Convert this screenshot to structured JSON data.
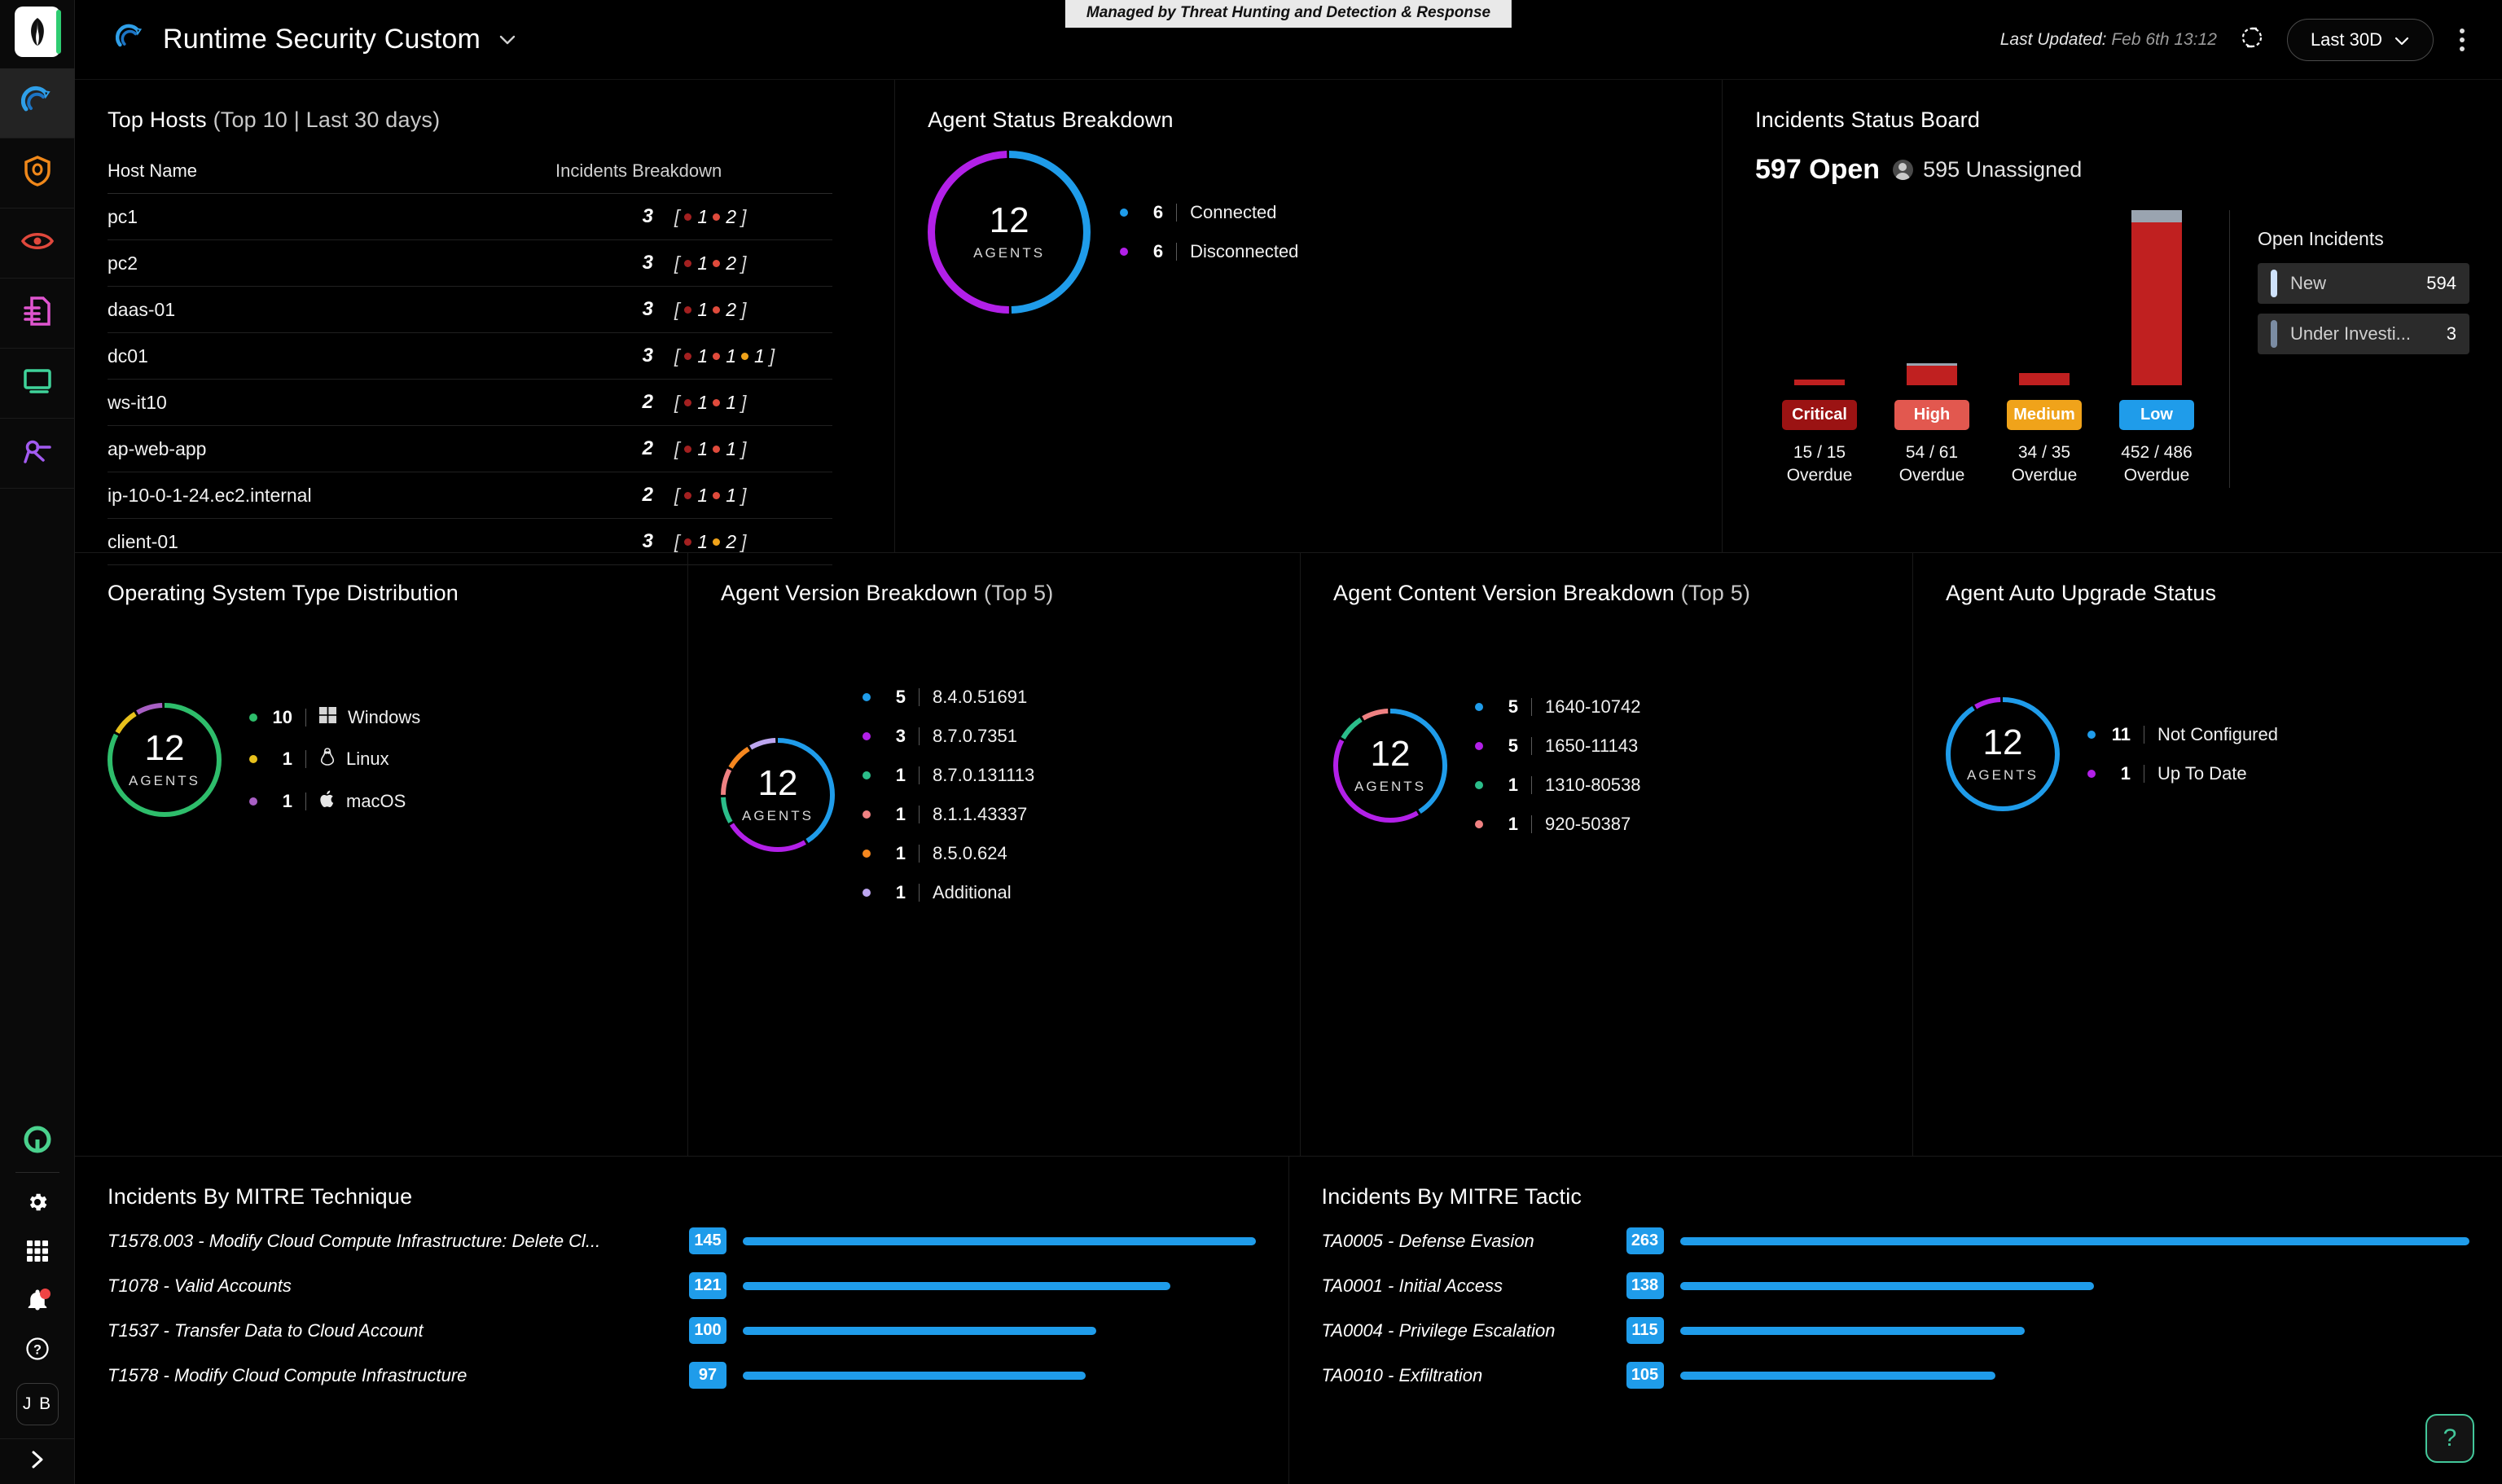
{
  "sidebar": {
    "logo_icon": "sentinelone-logo-icon",
    "nav_items": [
      {
        "name": "dashboard",
        "icon": "speedometer-icon",
        "color": "#2f9fe8",
        "active": true
      },
      {
        "name": "endpoint-protection",
        "icon": "shield-icon",
        "color": "#f0881a",
        "active": false
      },
      {
        "name": "visibility",
        "icon": "eye-icon",
        "color": "#e0483c",
        "active": false
      },
      {
        "name": "reports",
        "icon": "document-icon",
        "color": "#e055cf",
        "active": false
      },
      {
        "name": "devices",
        "icon": "monitor-icon",
        "color": "#3fd39a",
        "active": false
      },
      {
        "name": "integrations",
        "icon": "node-graph-icon",
        "color": "#a25bf0",
        "active": false
      }
    ],
    "bottom_items": [
      {
        "name": "singularity-marketplace",
        "icon": "ring-icon"
      },
      {
        "name": "settings",
        "icon": "gear-icon"
      },
      {
        "name": "apps-grid",
        "icon": "grid-icon"
      },
      {
        "name": "notifications",
        "icon": "bell-icon",
        "badge": true
      },
      {
        "name": "help",
        "icon": "question-circle-icon"
      }
    ],
    "avatar_initials": "J B",
    "expander_icon": "chevron-right-icon"
  },
  "header": {
    "title": "Runtime Security Custom",
    "title_chevron": "chevron-down-icon",
    "brand_icon": "speedometer-icon",
    "managed_banner": "Managed by Threat Hunting and Detection & Response",
    "last_updated_label": "Last Updated:",
    "last_updated_value": "Feb 6th 13:12",
    "refresh_icon": "refresh-icon",
    "time_range": "Last 30D",
    "time_range_chevron": "chevron-down-icon",
    "menu_icon": "kebab-menu-icon"
  },
  "top_hosts": {
    "title": "Top Hosts",
    "title_sub": "(Top 10 | Last 30 days)",
    "columns": [
      "Host Name",
      "Incidents Breakdown"
    ],
    "rows": [
      {
        "host": "pc1",
        "count": "3",
        "breakdown": [
          {
            "color": "#a32020",
            "value": "1"
          },
          {
            "color": "#e04b3c",
            "value": "2"
          }
        ]
      },
      {
        "host": "pc2",
        "count": "3",
        "breakdown": [
          {
            "color": "#a32020",
            "value": "1"
          },
          {
            "color": "#e04b3c",
            "value": "2"
          }
        ]
      },
      {
        "host": "daas-01",
        "count": "3",
        "breakdown": [
          {
            "color": "#a32020",
            "value": "1"
          },
          {
            "color": "#e04b3c",
            "value": "2"
          }
        ]
      },
      {
        "host": "dc01",
        "count": "3",
        "breakdown": [
          {
            "color": "#a32020",
            "value": "1"
          },
          {
            "color": "#e04b3c",
            "value": "1"
          },
          {
            "color": "#f0a31a",
            "value": "1"
          }
        ]
      },
      {
        "host": "ws-it10",
        "count": "2",
        "breakdown": [
          {
            "color": "#a32020",
            "value": "1"
          },
          {
            "color": "#e04b3c",
            "value": "1"
          }
        ]
      },
      {
        "host": "ap-web-app",
        "count": "2",
        "breakdown": [
          {
            "color": "#a32020",
            "value": "1"
          },
          {
            "color": "#e04b3c",
            "value": "1"
          }
        ]
      },
      {
        "host": "ip-10-0-1-24.ec2.internal",
        "count": "2",
        "breakdown": [
          {
            "color": "#a32020",
            "value": "1"
          },
          {
            "color": "#e04b3c",
            "value": "1"
          }
        ]
      },
      {
        "host": "client-01",
        "count": "3",
        "breakdown": [
          {
            "color": "#a32020",
            "value": "1"
          },
          {
            "color": "#f0a31a",
            "value": "2"
          }
        ]
      }
    ]
  },
  "agent_status": {
    "title": "Agent Status Breakdown",
    "center_value": "12",
    "center_label": "AGENTS",
    "legend": [
      {
        "value": "6",
        "label": "Connected",
        "color": "#1f9cea"
      },
      {
        "value": "6",
        "label": "Disconnected",
        "color": "#b220e8"
      }
    ]
  },
  "incidents_status_board": {
    "title": "Incidents Status Board",
    "open_count": "597 Open",
    "unassigned": "595 Unassigned",
    "unassigned_icon": "person-icon",
    "severities": [
      {
        "label": "Critical",
        "pill_color": "#9b1313",
        "overdue": "15",
        "total": "15",
        "sub": "15 / 15",
        "sub2": "Overdue"
      },
      {
        "label": "High",
        "pill_color": "#e2584f",
        "overdue": "54",
        "total": "61",
        "sub": "54 / 61",
        "sub2": "Overdue"
      },
      {
        "label": "Medium",
        "pill_color": "#f0a31a",
        "overdue": "34",
        "total": "35",
        "sub": "34 / 35",
        "sub2": "Overdue"
      },
      {
        "label": "Low",
        "pill_color": "#1f9cea",
        "overdue": "452",
        "total": "486",
        "sub": "452 / 486",
        "sub2": "Overdue"
      }
    ],
    "open_incidents_title": "Open Incidents",
    "open_incidents": [
      {
        "label": "New",
        "count": "594",
        "accent": "#cfe2fa"
      },
      {
        "label": "Under Investi...",
        "count": "3",
        "accent": "#7b8ca3"
      }
    ]
  },
  "os_distribution": {
    "title": "Operating System Type Distribution",
    "center_value": "12",
    "center_label": "AGENTS",
    "legend": [
      {
        "value": "10",
        "label": "Windows",
        "color": "#2ebd6b",
        "icon": "windows-icon"
      },
      {
        "value": "1",
        "label": "Linux",
        "color": "#e8c11c",
        "icon": "linux-icon"
      },
      {
        "value": "1",
        "label": "macOS",
        "color": "#a85fc4",
        "icon": "apple-icon"
      }
    ]
  },
  "agent_version": {
    "title": "Agent Version Breakdown",
    "title_sub": "(Top 5)",
    "center_value": "12",
    "center_label": "AGENTS",
    "legend": [
      {
        "value": "5",
        "label": "8.4.0.51691",
        "color": "#1f9cea"
      },
      {
        "value": "3",
        "label": "8.7.0.7351",
        "color": "#b220e8"
      },
      {
        "value": "1",
        "label": "8.7.0.131113",
        "color": "#2bbd8a"
      },
      {
        "value": "1",
        "label": "8.1.1.43337",
        "color": "#ef8182"
      },
      {
        "value": "1",
        "label": "8.5.0.624",
        "color": "#f5871f"
      },
      {
        "value": "1",
        "label": "Additional",
        "color": "#bda6f0"
      }
    ]
  },
  "agent_content_version": {
    "title": "Agent Content Version Breakdown",
    "title_sub": "(Top 5)",
    "center_value": "12",
    "center_label": "AGENTS",
    "legend": [
      {
        "value": "5",
        "label": "1640-10742",
        "color": "#1f9cea"
      },
      {
        "value": "5",
        "label": "1650-11143",
        "color": "#b220e8"
      },
      {
        "value": "1",
        "label": "1310-80538",
        "color": "#2bbd8a"
      },
      {
        "value": "1",
        "label": "920-50387",
        "color": "#ef8182"
      }
    ]
  },
  "agent_auto_upgrade": {
    "title": "Agent Auto Upgrade Status",
    "center_value": "12",
    "center_label": "AGENTS",
    "legend": [
      {
        "value": "11",
        "label": "Not Configured",
        "color": "#1f9cea"
      },
      {
        "value": "1",
        "label": "Up To Date",
        "color": "#b220e8"
      }
    ]
  },
  "mitre_technique": {
    "title": "Incidents By MITRE Technique",
    "rows": [
      {
        "label": "T1578.003 - Modify Cloud Compute Infrastructure: Delete Cl...",
        "value": "145"
      },
      {
        "label": "T1078 - Valid Accounts",
        "value": "121"
      },
      {
        "label": "T1537 - Transfer Data to Cloud Account",
        "value": "100"
      },
      {
        "label": "T1578 - Modify Cloud Compute Infrastructure",
        "value": "97"
      }
    ]
  },
  "mitre_tactic": {
    "title": "Incidents By MITRE Tactic",
    "rows": [
      {
        "label": "TA0005 - Defense Evasion",
        "value": "263"
      },
      {
        "label": "TA0001 - Initial Access",
        "value": "138"
      },
      {
        "label": "TA0004 - Privilege Escalation",
        "value": "115"
      },
      {
        "label": "TA0010 - Exfiltration",
        "value": "105"
      }
    ]
  },
  "help_button": {
    "icon": "question-icon",
    "label": "?"
  },
  "chart_data": [
    {
      "type": "pie",
      "title": "Agent Status Breakdown",
      "categories": [
        "Connected",
        "Disconnected"
      ],
      "values": [
        6,
        6
      ],
      "colors": [
        "#1f9cea",
        "#b220e8"
      ],
      "total": 12,
      "center_label": "AGENTS",
      "legend": "right"
    },
    {
      "type": "bar",
      "title": "Incidents Status Board",
      "categories": [
        "Critical",
        "High",
        "Medium",
        "Low"
      ],
      "series": [
        {
          "name": "Overdue",
          "values": [
            15,
            54,
            34,
            452
          ]
        },
        {
          "name": "Total",
          "values": [
            15,
            61,
            35,
            486
          ]
        }
      ],
      "ylim": [
        0,
        486
      ],
      "grid": false,
      "xlabel": "",
      "ylabel": ""
    },
    {
      "type": "pie",
      "title": "Operating System Type Distribution",
      "categories": [
        "Windows",
        "Linux",
        "macOS"
      ],
      "values": [
        10,
        1,
        1
      ],
      "colors": [
        "#2ebd6b",
        "#e8c11c",
        "#a85fc4"
      ],
      "total": 12,
      "center_label": "AGENTS",
      "legend": "right"
    },
    {
      "type": "pie",
      "title": "Agent Version Breakdown (Top 5)",
      "categories": [
        "8.4.0.51691",
        "8.7.0.7351",
        "8.7.0.131113",
        "8.1.1.43337",
        "8.5.0.624",
        "Additional"
      ],
      "values": [
        5,
        3,
        1,
        1,
        1,
        1
      ],
      "colors": [
        "#1f9cea",
        "#b220e8",
        "#2bbd8a",
        "#ef8182",
        "#f5871f",
        "#bda6f0"
      ],
      "total": 12,
      "center_label": "AGENTS",
      "legend": "right"
    },
    {
      "type": "pie",
      "title": "Agent Content Version Breakdown (Top 5)",
      "categories": [
        "1640-10742",
        "1650-11143",
        "1310-80538",
        "920-50387"
      ],
      "values": [
        5,
        5,
        1,
        1
      ],
      "colors": [
        "#1f9cea",
        "#b220e8",
        "#2bbd8a",
        "#ef8182"
      ],
      "total": 12,
      "center_label": "AGENTS",
      "legend": "right"
    },
    {
      "type": "pie",
      "title": "Agent Auto Upgrade Status",
      "categories": [
        "Not Configured",
        "Up To Date"
      ],
      "values": [
        11,
        1
      ],
      "colors": [
        "#1f9cea",
        "#b220e8"
      ],
      "total": 12,
      "center_label": "AGENTS",
      "legend": "right"
    },
    {
      "type": "bar",
      "title": "Incidents By MITRE Technique",
      "orientation": "horizontal",
      "categories": [
        "T1578.003 - Modify Cloud Compute Infrastructure: Delete Cl...",
        "T1078 - Valid Accounts",
        "T1537 - Transfer Data to Cloud Account",
        "T1578 - Modify Cloud Compute Infrastructure"
      ],
      "values": [
        145,
        121,
        100,
        97
      ],
      "color": "#1f9cea",
      "xlim": [
        0,
        145
      ]
    },
    {
      "type": "bar",
      "title": "Incidents By MITRE Tactic",
      "orientation": "horizontal",
      "categories": [
        "TA0005 - Defense Evasion",
        "TA0001 - Initial Access",
        "TA0004 - Privilege Escalation",
        "TA0010 - Exfiltration"
      ],
      "values": [
        263,
        138,
        115,
        105
      ],
      "color": "#1f9cea",
      "xlim": [
        0,
        263
      ]
    }
  ]
}
